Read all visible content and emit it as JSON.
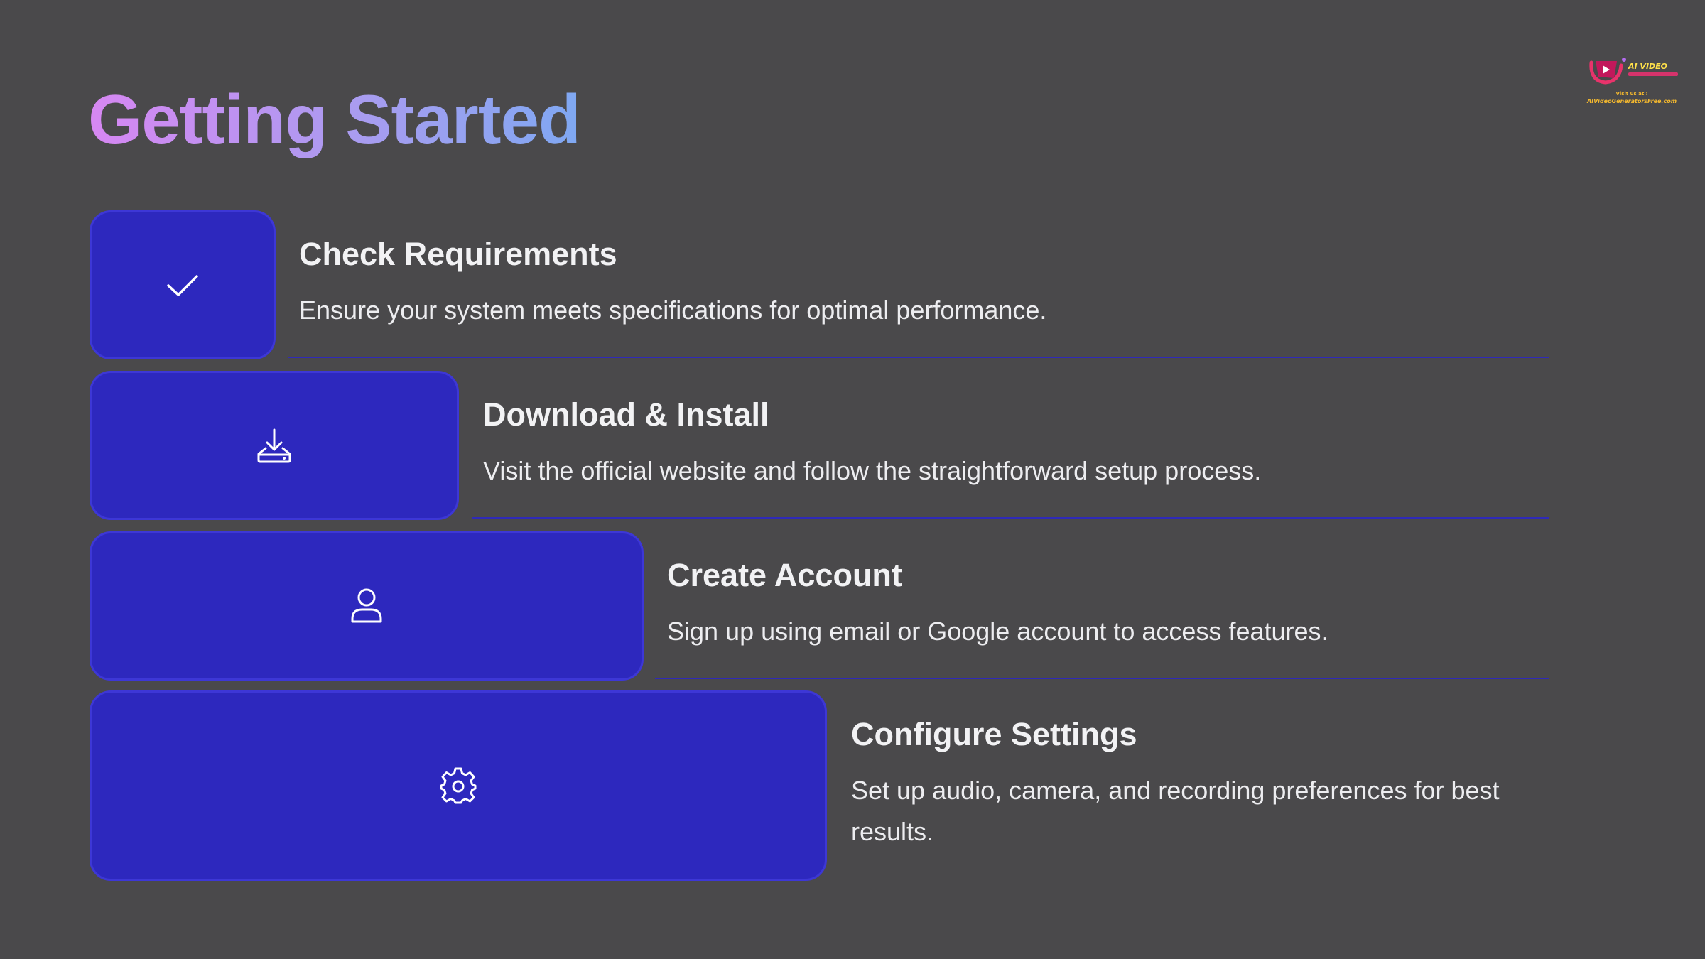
{
  "page": {
    "title": "Getting Started"
  },
  "brand": {
    "logo_text": "AI VIDEO",
    "visit_label": "Visit us at :",
    "url": "AIVideoGeneratorsFree.com"
  },
  "steps": [
    {
      "title": "Check Requirements",
      "description": "Ensure your system meets specifications for optimal performance.",
      "icon": "check-icon"
    },
    {
      "title": "Download & Install",
      "description": "Visit the official website and follow the straightforward setup process.",
      "icon": "download-icon"
    },
    {
      "title": "Create Account",
      "description": "Sign up using email or Google account to access features.",
      "icon": "user-icon"
    },
    {
      "title": "Configure Settings",
      "description": "Set up audio, camera, and recording preferences for best results.",
      "icon": "gear-icon"
    }
  ],
  "colors": {
    "background": "#4a494b",
    "block_fill": "#2d28be",
    "block_border": "#3d37d6",
    "divider": "#2f2ab8",
    "title_gradient_start": "#d787f2",
    "title_gradient_end": "#7fa8f2"
  }
}
